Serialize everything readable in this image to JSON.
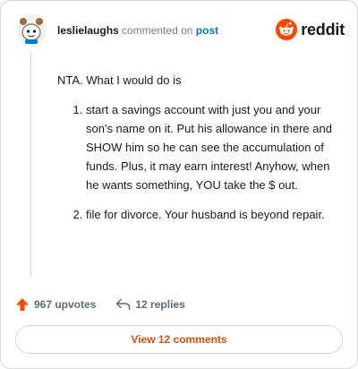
{
  "header": {
    "username": "leslielaughs",
    "commented_on": "commented on",
    "post_link": "post",
    "brand": "reddit",
    "brand_color": "#ff4500",
    "avatar_icon": "snoo-avatar-icon"
  },
  "comment": {
    "intro": "NTA. What I would do is",
    "items": [
      "start a savings account with just you and your son's name on it. Put his allowance in there and SHOW him so he can see the accumulation of funds. Plus, it may earn interest! Anyhow, when he wants something, YOU take the $ out.",
      "file for divorce. Your husband is beyond repair."
    ]
  },
  "actions": {
    "upvotes_label": "967 upvotes",
    "replies_label": "12 replies",
    "upvote_icon": "upvote-arrow-icon",
    "reply_icon": "reply-arrow-icon",
    "upvote_color": "#ff4500"
  },
  "footer": {
    "view_comments_label": "View 12 comments",
    "view_comments_color": "#e4480a"
  }
}
